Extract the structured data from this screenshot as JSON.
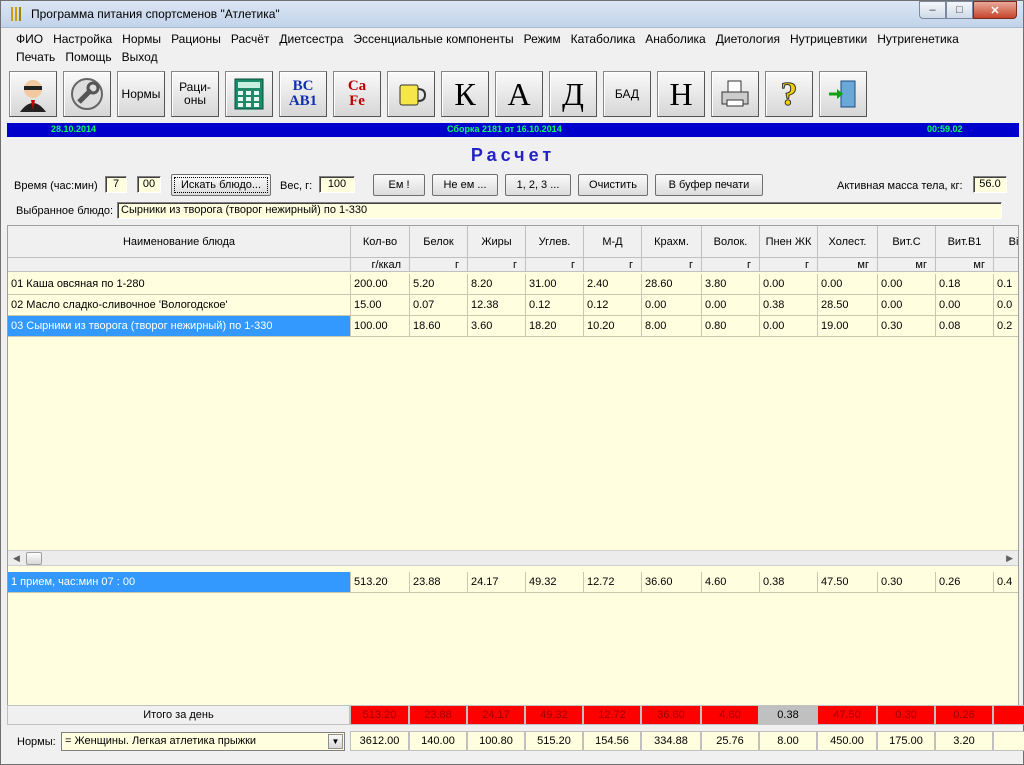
{
  "window": {
    "title": "Программа питания спортсменов \"Атлетика\"",
    "min_label": "–",
    "max_label": "□",
    "close_label": "✕"
  },
  "menu": {
    "row1": [
      "ФИО",
      "Настройка",
      "Нормы",
      "Рационы",
      "Расчёт",
      "Диетсестра",
      "Эссенциальные компоненты",
      "Режим",
      "Катаболика",
      "Анаболика",
      "Диетология",
      "Нутрицевтики",
      "Нутригенетика"
    ],
    "row2": [
      "Печать",
      "Помощь",
      "Выход"
    ]
  },
  "toolbar": {
    "items": [
      {
        "icon": "person-icon",
        "label": ""
      },
      {
        "icon": "wrench-icon",
        "label": ""
      },
      {
        "icon": "",
        "label": "Нормы"
      },
      {
        "icon": "",
        "label": "Раци-\nоны"
      },
      {
        "icon": "calculator-icon",
        "label": ""
      },
      {
        "icon": "vitamins-abc-icon",
        "label": ""
      },
      {
        "icon": "minerals-icon",
        "label": ""
      },
      {
        "icon": "cup-icon",
        "label": ""
      },
      {
        "icon": "",
        "label": "К"
      },
      {
        "icon": "",
        "label": "А"
      },
      {
        "icon": "",
        "label": "Д"
      },
      {
        "icon": "",
        "label": "БАД"
      },
      {
        "icon": "",
        "label": "Н"
      },
      {
        "icon": "printer-icon",
        "label": ""
      },
      {
        "icon": "help-icon",
        "label": ""
      },
      {
        "icon": "exit-icon",
        "label": ""
      }
    ],
    "vitamins_text": "BC\nAB1",
    "minerals_text": "Ca\nFe",
    "help_text": "?"
  },
  "status": {
    "date": "28.10.2014",
    "build": "Сборка 2181 от 16.10.2014",
    "time": "00:59.02"
  },
  "calc": {
    "heading": "Расчет",
    "time_label": "Время (час:мин)",
    "hour": "7",
    "minute": "00",
    "search_button": "Искать блюдо...",
    "weight_label": "Вес, г:",
    "weight": "100",
    "buttons": [
      "Ем !",
      "Не ем ...",
      "1, 2, 3 ...",
      "Очистить",
      "В буфер печати"
    ],
    "active_mass_label": "Активная масса тела, кг:",
    "active_mass": "56.0",
    "selected_label": "Выбранное блюдо:",
    "selected_value": "Сырники из творога (творог нежирный) по 1-330"
  },
  "table": {
    "name_header": "Наименование блюда",
    "columns": [
      {
        "name": "Кол-во",
        "unit": "г/ккал"
      },
      {
        "name": "Белок",
        "unit": "г"
      },
      {
        "name": "Жиры",
        "unit": "г"
      },
      {
        "name": "Углев.",
        "unit": "г"
      },
      {
        "name": "М-Д",
        "unit": "г"
      },
      {
        "name": "Крахм.",
        "unit": "г"
      },
      {
        "name": "Волок.",
        "unit": "г"
      },
      {
        "name": "Пнен ЖК",
        "unit": "г"
      },
      {
        "name": "Холест.",
        "unit": "мг"
      },
      {
        "name": "Вит.С",
        "unit": "мг"
      },
      {
        "name": "Вит.B1",
        "unit": "мг"
      },
      {
        "name": "Ві",
        "unit": ""
      }
    ],
    "rows": [
      {
        "name": "01 Каша овсяная по 1-280",
        "values": [
          "200.00",
          "5.20",
          "8.20",
          "31.00",
          "2.40",
          "28.60",
          "3.80",
          "0.00",
          "0.00",
          "0.00",
          "0.18",
          "0.1"
        ]
      },
      {
        "name": "02 Масло сладко-сливочное 'Вологодское'",
        "values": [
          "15.00",
          "0.07",
          "12.38",
          "0.12",
          "0.12",
          "0.00",
          "0.00",
          "0.38",
          "28.50",
          "0.00",
          "0.00",
          "0.0"
        ]
      },
      {
        "name": "03 Сырники из творога (творог нежирный) по 1-330",
        "values": [
          "100.00",
          "18.60",
          "3.60",
          "18.20",
          "10.20",
          "8.00",
          "0.80",
          "0.00",
          "19.00",
          "0.30",
          "0.08",
          "0.2"
        ]
      }
    ],
    "meal_row": {
      "name": "1 прием, час:мин  07 : 00",
      "values": [
        "513.20",
        "23.88",
        "24.17",
        "49.32",
        "12.72",
        "36.60",
        "4.60",
        "0.38",
        "47.50",
        "0.30",
        "0.26",
        "0.4"
      ]
    },
    "total_label": "Итого за день",
    "totals": [
      "513.20",
      "23.88",
      "24.17",
      "49.32",
      "12.72",
      "36.60",
      "4.60",
      "0.38",
      "47.50",
      "0.30",
      "0.26",
      ""
    ],
    "norms_label": "Нормы:",
    "norms_select": "= Женщины. Легкая атлетика прыжки",
    "norms": [
      "3612.00",
      "140.00",
      "100.80",
      "515.20",
      "154.56",
      "334.88",
      "25.76",
      "8.00",
      "450.00",
      "175.00",
      "3.20",
      ""
    ]
  },
  "colors": {
    "status_bg": "#0000cc",
    "status_text": "#00ff66",
    "grid_bg": "#ffffe0",
    "selection": "#3399ff",
    "deficit": "#ff0000",
    "heading": "#2323c8"
  }
}
